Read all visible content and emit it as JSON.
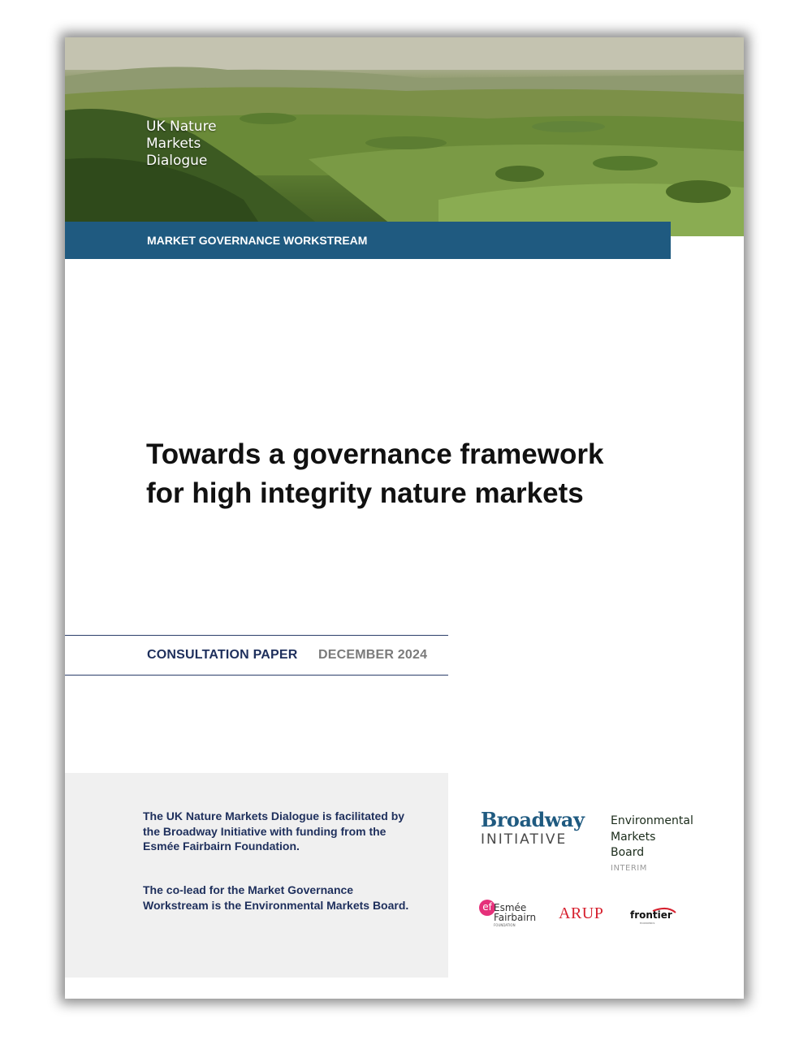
{
  "cover": {
    "hero_title_lines": [
      "UK Nature",
      "Markets",
      "Dialogue"
    ],
    "band_label": "MARKET GOVERNANCE WORKSTREAM",
    "title_lines": [
      "Towards a governance framework",
      "for high integrity nature markets"
    ],
    "paper_type": "CONSULTATION PAPER",
    "paper_date": "DECEMBER 2024",
    "info_paragraph_1": "The UK Nature Markets Dialogue is facilitated by the Broadway Initiative with funding from the Esmée Fairbairn Foundation.",
    "info_paragraph_2": "The co-lead for the Market Governance Workstream is the Environmental Markets Board."
  },
  "logos": {
    "broadway": {
      "line1": "Broadway",
      "line2": "INITIATIVE"
    },
    "emb": {
      "lines": [
        "Environmental",
        "Markets",
        "Board"
      ],
      "sub": "INTERIM"
    },
    "esmee": {
      "mark": "ef",
      "lines": [
        "Esmée",
        "Fairbairn"
      ],
      "sub": "FOUNDATION"
    },
    "arup": "ARUP",
    "frontier": {
      "name": "frontier",
      "sub": "ECONOMICS"
    }
  },
  "colors": {
    "band": "#1f5a80",
    "navy_text": "#1e2f5c",
    "grey_box": "#f0f0f0",
    "esmee_pink": "#e5307a",
    "arup_red": "#d6202e"
  }
}
